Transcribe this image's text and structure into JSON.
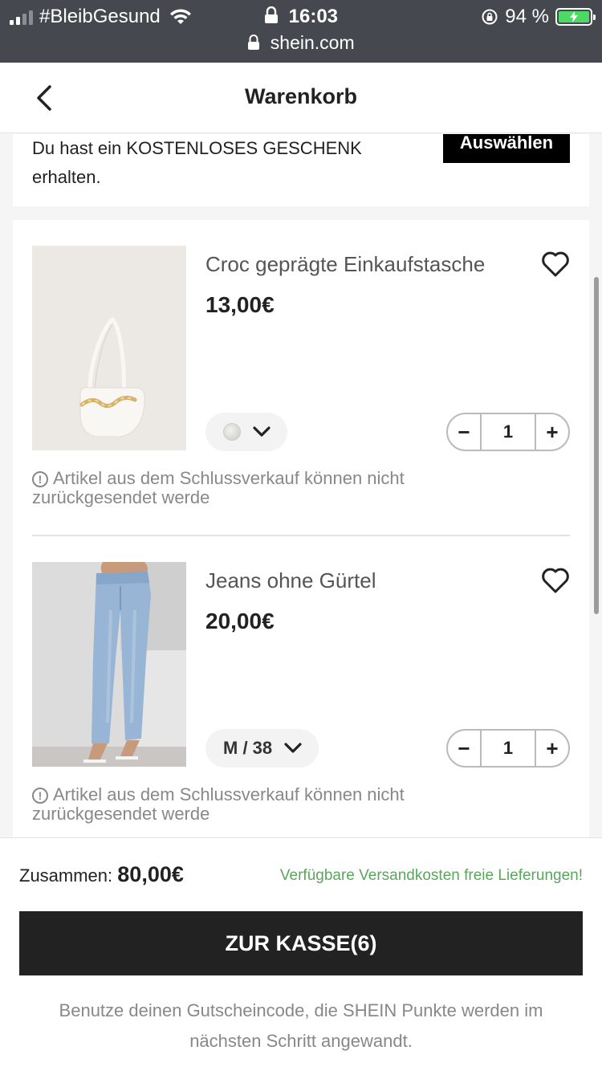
{
  "status_bar": {
    "carrier": "#BleibGesund",
    "time": "16:03",
    "battery": "94 %",
    "url": "shein.com"
  },
  "header": {
    "title": "Warenkorb",
    "back_icon": "chevron-left-icon"
  },
  "gift_banner": {
    "text": "Du hast ein KOSTENLOSES GESCHENK erhalten.",
    "button_label": "Auswählen"
  },
  "cart_items": [
    {
      "name": "Croc geprägte Einkaufstasche",
      "price": "13,00€",
      "variant_label": "",
      "quantity": "1",
      "note": "Artikel aus dem Schlussverkauf können nicht zurückgesendet werde"
    },
    {
      "name": "Jeans ohne Gürtel",
      "price": "20,00€",
      "variant_label": "M / 38",
      "quantity": "1",
      "note": "Artikel aus dem Schlussverkauf können nicht zurückgesendet werde"
    }
  ],
  "footer": {
    "total_label": "Zusammen:",
    "total_value": "80,00€",
    "shipping_note": "Verfügbare Versandkosten freie Lieferungen!",
    "checkout_label": "ZUR KASSE(6)",
    "hint": "Benutze deinen Gutscheincode, die SHEIN Punkte werden im nächsten Schritt angewandt."
  },
  "colors": {
    "status_bar_bg": "#45494f",
    "checkout_bg": "#222222",
    "shipping_green": "#5ba55e",
    "battery_green": "#4cd964"
  }
}
